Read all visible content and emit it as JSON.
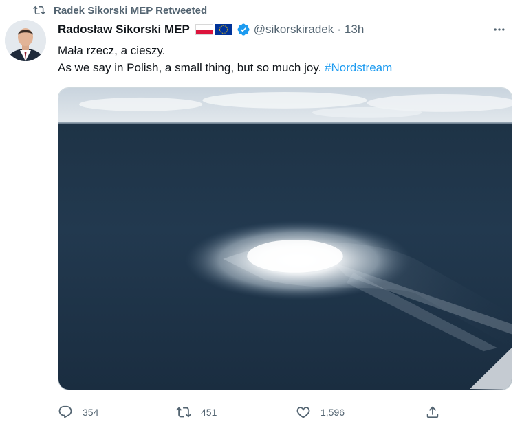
{
  "retweet_banner": {
    "text": "Radek Sikorski MEP Retweeted",
    "icon": "retweet-icon"
  },
  "tweet": {
    "author_name": "Radosław Sikorski MEP",
    "flags": [
      "poland-flag-icon",
      "eu-flag-icon"
    ],
    "verified_icon": "verified-badge-icon",
    "handle": "@sikorskiradek",
    "separator": "·",
    "time": "13h",
    "text_line1": "Mała rzecz, a cieszy.",
    "text_line2": "As we say in Polish, a small thing, but so much joy. ",
    "hashtag": "#Nordstream",
    "media_description_icon": "sea-gas-leak-photo"
  },
  "actions": {
    "reply_count": "354",
    "retweet_count": "451",
    "like_count": "1,596"
  },
  "colors": {
    "text": "#0f1419",
    "secondary": "#536471",
    "link": "#1d9bf0",
    "verified": "#1d9bf0"
  }
}
